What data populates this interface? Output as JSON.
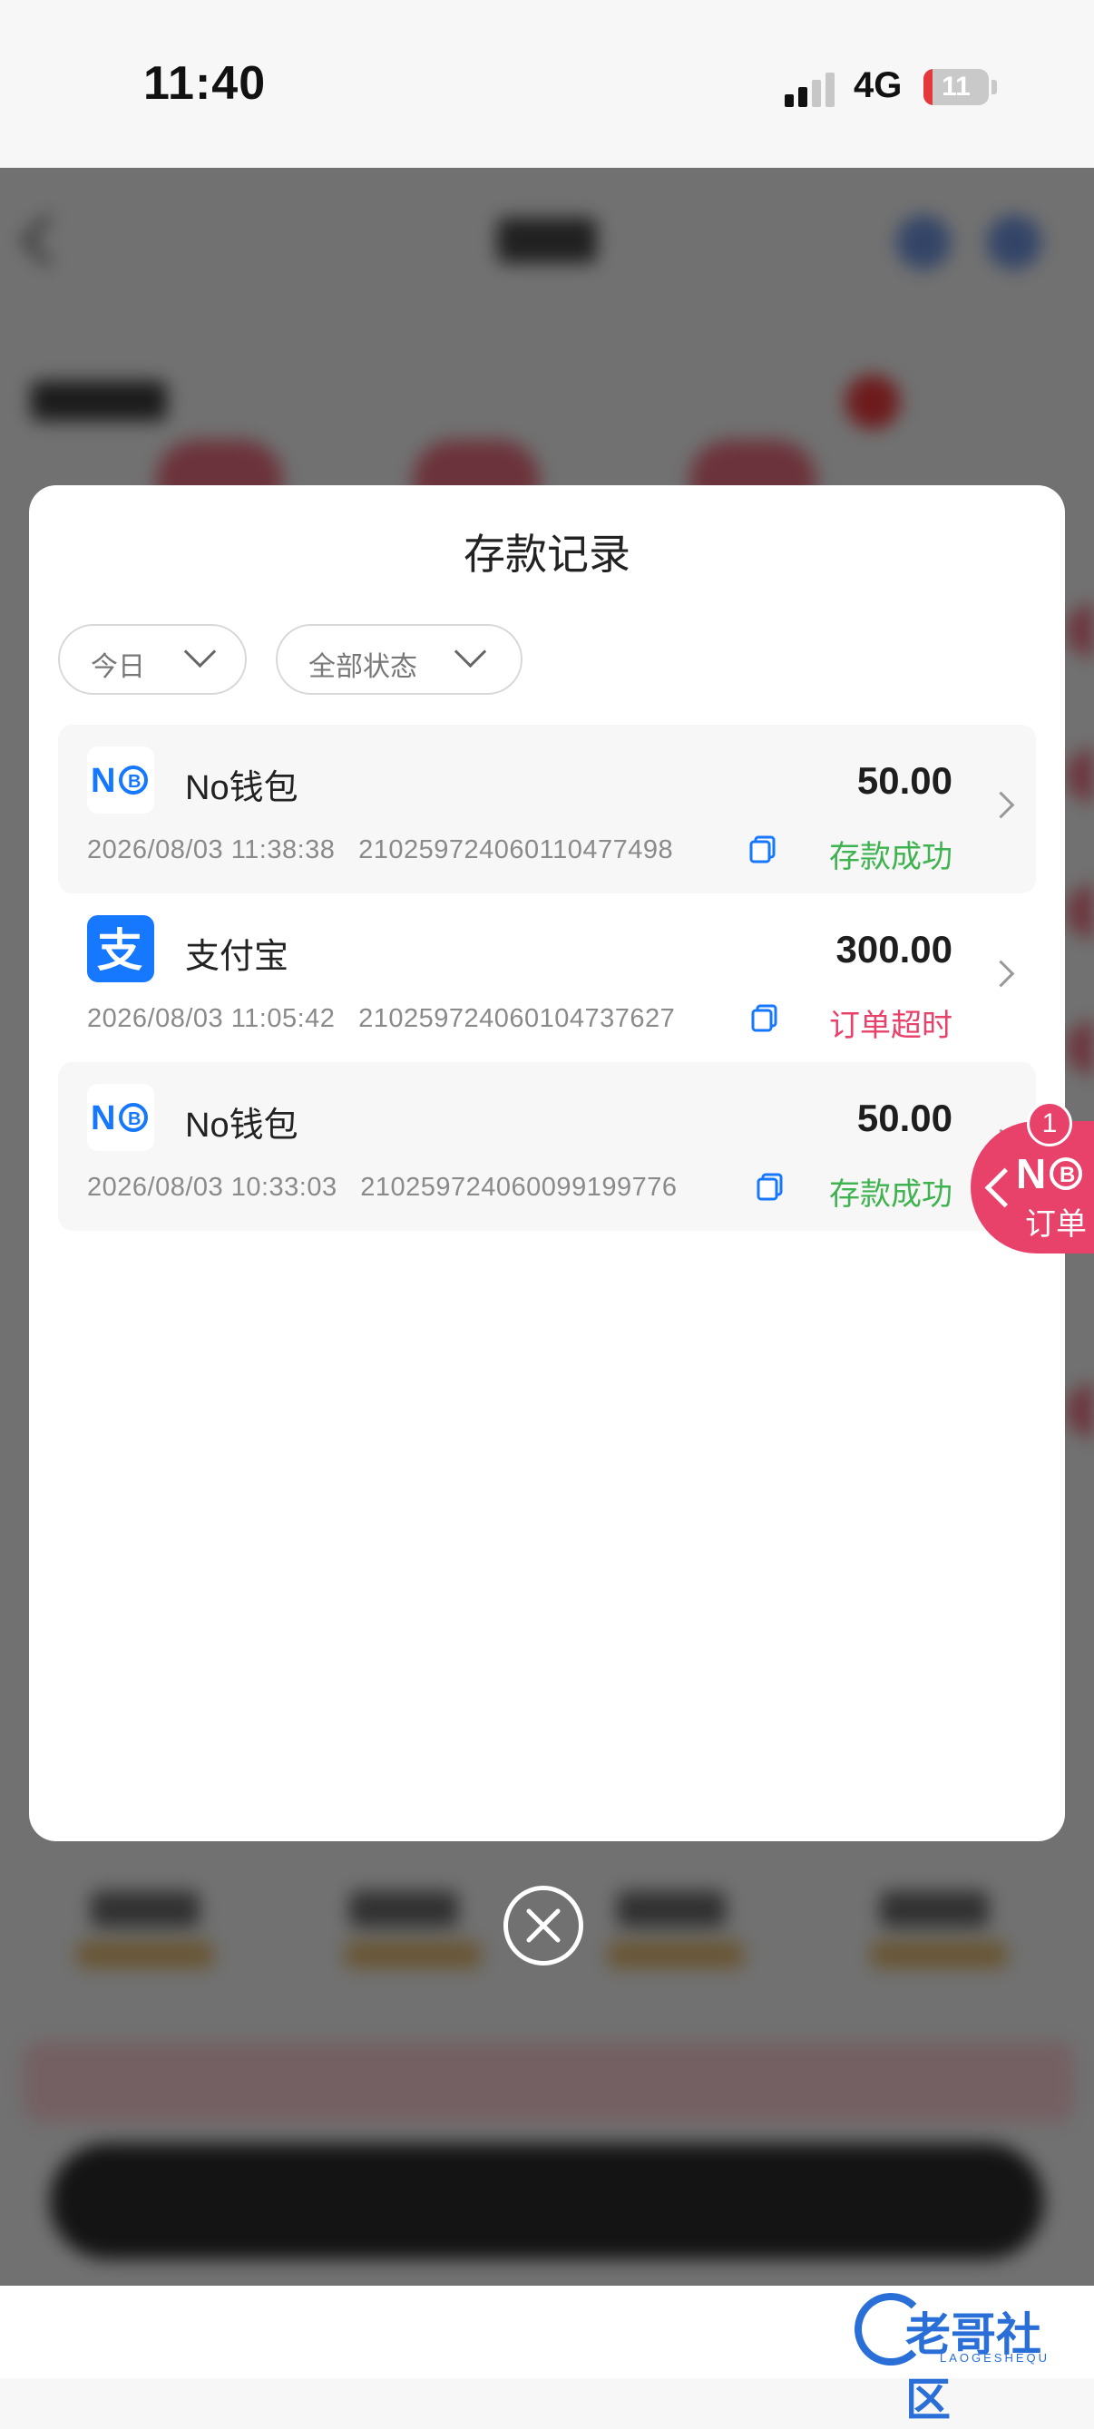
{
  "status_bar": {
    "time": "11:40",
    "network": "4G",
    "battery": "11"
  },
  "modal": {
    "title": "存款记录",
    "filters": [
      {
        "label": "今日"
      },
      {
        "label": "全部状态"
      }
    ],
    "records": [
      {
        "method": "No钱包",
        "icon": "nobtc-icon",
        "amount": "50.00",
        "datetime": "2026/08/03 11:38:38",
        "order_id": "2102597240601104774​98",
        "status": "存款成功",
        "status_color": "#3fb34f"
      },
      {
        "method": "支付宝",
        "icon": "alipay-icon",
        "amount": "300.00",
        "datetime": "2026/08/03 11:05:42",
        "order_id": "210259724060104737627",
        "status": "订单超时",
        "status_color": "#e8426b"
      },
      {
        "method": "No钱包",
        "icon": "nobtc-icon",
        "amount": "50.00",
        "datetime": "2026/08/03 10:33:03",
        "order_id": "210259724060099199776",
        "status": "存款成功",
        "status_color": "#3fb34f"
      }
    ]
  },
  "float_tab": {
    "badge": "1",
    "label": "订单"
  },
  "watermark": {
    "text": "老哥社区",
    "subtext": "LAOGESHEQU"
  },
  "colors": {
    "accent_pink": "#e8426b",
    "success_green": "#3fb34f",
    "brand_blue": "#1677ff"
  }
}
